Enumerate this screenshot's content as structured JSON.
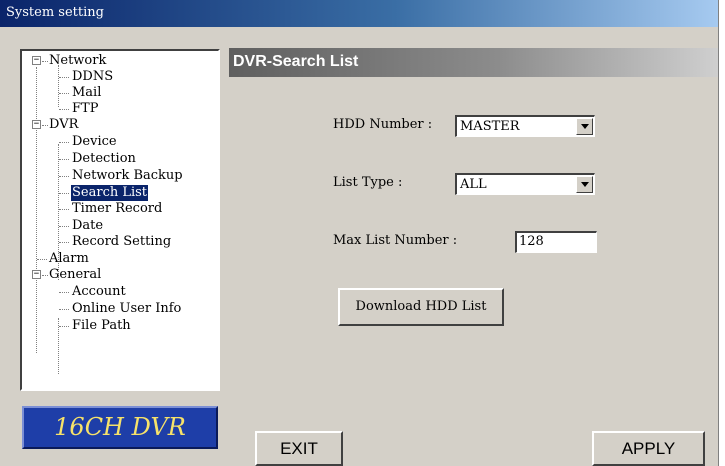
{
  "window": {
    "title": "System setting"
  },
  "tree": {
    "items": [
      {
        "label": "Network",
        "expander": "−"
      },
      {
        "label": "DDNS"
      },
      {
        "label": "Mail"
      },
      {
        "label": "FTP"
      },
      {
        "label": "DVR",
        "expander": "−"
      },
      {
        "label": "Device"
      },
      {
        "label": "Detection"
      },
      {
        "label": "Network Backup"
      },
      {
        "label": "Search List",
        "selected": true
      },
      {
        "label": "Timer Record"
      },
      {
        "label": "Date"
      },
      {
        "label": "Record Setting"
      },
      {
        "label": "Alarm"
      },
      {
        "label": "General",
        "expander": "−"
      },
      {
        "label": "Account"
      },
      {
        "label": "Online User Info"
      },
      {
        "label": "File Path"
      }
    ]
  },
  "logo": {
    "text": "16CH DVR"
  },
  "panel": {
    "header": "DVR-Search List",
    "hdd_number": {
      "label": "HDD Number :",
      "value": "MASTER"
    },
    "list_type": {
      "label": "List Type :",
      "value": "ALL"
    },
    "max_list": {
      "label": "Max List Number :",
      "value": "128"
    },
    "download_button": "Download HDD List"
  },
  "footer": {
    "exit": "EXIT",
    "apply": "APPLY"
  },
  "colors": {
    "title_bar": "#0a246a",
    "selection": "#0a246a",
    "logo_bg": "#1e3ea8",
    "logo_text": "#f7e26a"
  }
}
